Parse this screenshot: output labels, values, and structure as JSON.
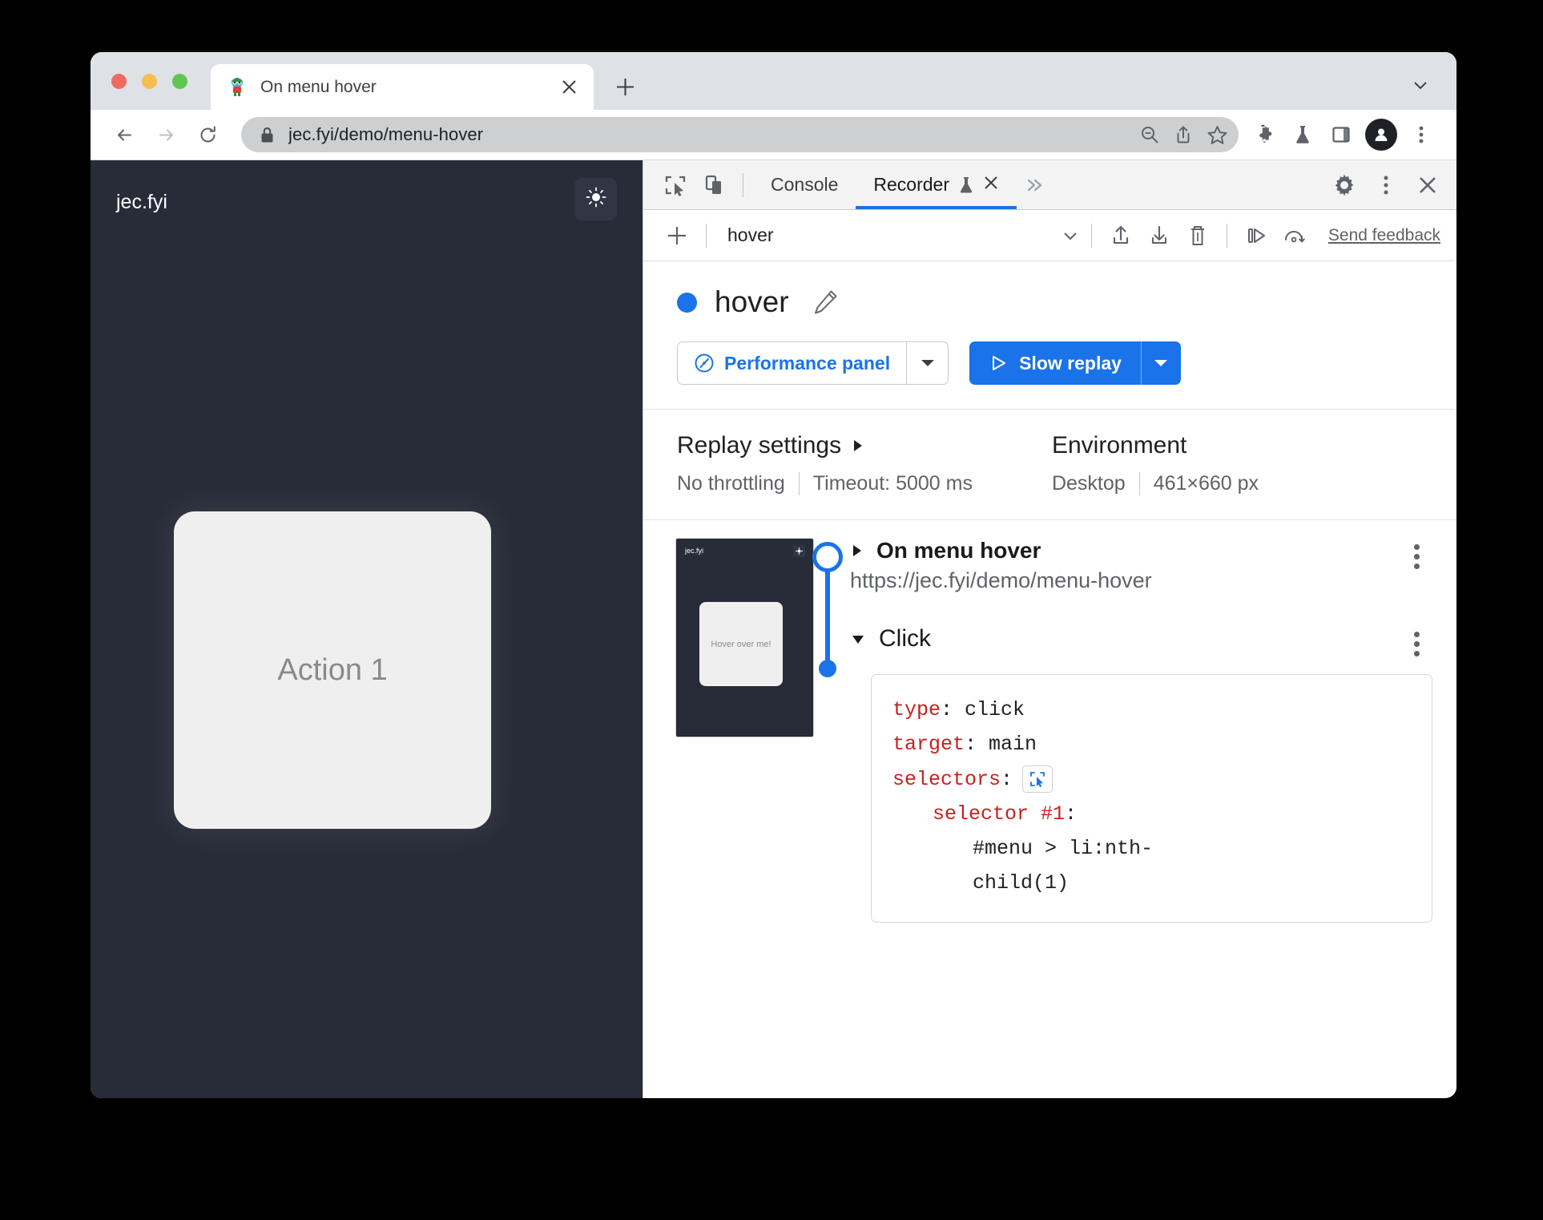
{
  "browser": {
    "tab": {
      "title": "On menu hover",
      "favicon": "puzzle-mascot-favicon",
      "close_label": "×"
    },
    "new_tab_label": "+",
    "omnibox": {
      "url": "jec.fyi/demo/menu-hover",
      "lock_icon": "lock-icon"
    },
    "toolbar_icons": [
      "zoom-out-icon",
      "share-icon",
      "bookmark-star-icon",
      "extensions-puzzle-icon",
      "flask-icon",
      "side-panel-icon",
      "profile-avatar-icon",
      "browser-menu-kebab-icon"
    ]
  },
  "page": {
    "brand": "jec.fyi",
    "theme_toggle_icon": "sun-icon",
    "card_label": "Action 1"
  },
  "devtools": {
    "tabs": [
      {
        "label": "Console",
        "active": false
      },
      {
        "label": "Recorder",
        "active": true,
        "experimental_icon": "flask-icon",
        "close_label": "×"
      }
    ],
    "more_tabs_label": "»",
    "left_icons": [
      "inspect-element-icon",
      "device-toolbar-icon"
    ],
    "right_icons": [
      "settings-gear-icon",
      "devtools-menu-kebab-icon",
      "close-devtools-icon"
    ]
  },
  "recorder": {
    "toolbar": {
      "add_label": "+",
      "selected_recording": "hover",
      "caret": "∨",
      "import_icon": "import-upload-icon",
      "export_icon": "export-download-icon",
      "delete_icon": "trash-icon",
      "step_replay_icon": "step-replay-icon",
      "measure_icon": "performance-replay-icon",
      "feedback_label": "Send feedback"
    },
    "header": {
      "title": "hover",
      "edit_icon": "pencil-icon",
      "perf_button_label": "Performance panel",
      "perf_button_icon": "performance-gauge-icon",
      "replay_button_label": "Slow replay",
      "replay_button_icon": "play-triangle-icon",
      "accent_color": "#1a73e8"
    },
    "settings": {
      "replay_heading": "Replay settings",
      "replay_values": [
        "No throttling",
        "Timeout: 5000 ms"
      ],
      "environment_heading": "Environment",
      "environment_values": [
        "Desktop",
        "461×660 px"
      ]
    },
    "thumbnail": {
      "brand": "jec.fyi",
      "card_label": "Hover over me!",
      "button_icon": "sun-icon"
    },
    "steps": [
      {
        "title": "On menu hover",
        "url": "https://jec.fyi/demo/menu-hover",
        "expanded": false,
        "disclosure": "▶"
      },
      {
        "title": "Click",
        "expanded": true,
        "disclosure": "▼",
        "details": {
          "type_key": "type",
          "type_value": "click",
          "target_key": "target",
          "target_value": "main",
          "selectors_key": "selectors",
          "picker_icon": "selector-picker-icon",
          "selector_label": "selector #1",
          "selector_value_line1": "#menu > li:nth-",
          "selector_value_line2": "child(1)"
        }
      }
    ]
  }
}
